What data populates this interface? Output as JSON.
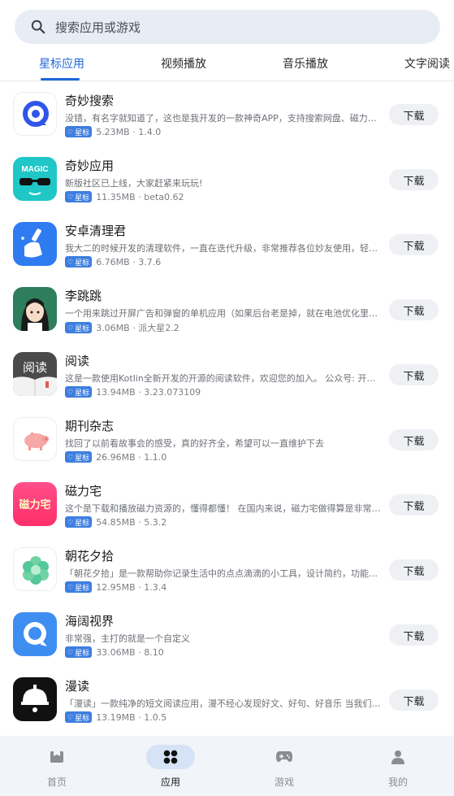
{
  "search": {
    "placeholder": "搜索应用或游戏",
    "icon": "search-icon"
  },
  "tabs": [
    {
      "label": "星标应用",
      "active": true
    },
    {
      "label": "视频播放",
      "active": false
    },
    {
      "label": "音乐播放",
      "active": false
    },
    {
      "label": "文字阅读",
      "active": false
    }
  ],
  "apps": [
    {
      "name": "奇妙搜索",
      "desc": "没错，有名字就知道了，这也是我开发的一款神奇APP，支持搜索网盘、磁力链接等",
      "badge": "星标",
      "meta": "5.23MB · 1.4.0",
      "button": "下载",
      "icon": "magic-search-icon"
    },
    {
      "name": "奇妙应用",
      "desc": "新版社区已上线，大家赶紧来玩玩!",
      "badge": "星标",
      "meta": "11.35MB · beta0.62",
      "button": "下载",
      "icon": "magic-app-icon",
      "icon_text": "MAGIC"
    },
    {
      "name": "安卓清理君",
      "desc": "我大二的时候开发的清理软件，一直在迭代升级，非常推荐各位妙友使用，轻量无广告",
      "badge": "星标",
      "meta": "6.76MB · 3.7.6",
      "button": "下载",
      "icon": "cleaner-icon"
    },
    {
      "name": "李跳跳",
      "desc": "一个用来跳过开屏广告和弹窗的单机应用（如果后台老是掉，就在电池优化里设置）",
      "badge": "星标",
      "meta": "3.06MB · 派大星2.2",
      "button": "下载",
      "icon": "li-tiaotiao-icon"
    },
    {
      "name": "阅读",
      "desc": "这是一款使用Kotlin全新开发的开源的阅读软件，欢迎您的加入。 公众号: 开源阅读",
      "badge": "星标",
      "meta": "13.94MB · 3.23.073109",
      "button": "下载",
      "icon": "legado-reader-icon",
      "icon_text": "阅读"
    },
    {
      "name": "期刊杂志",
      "desc": "找回了以前看故事会的感受，真的好齐全，希望可以一直维护下去",
      "badge": "星标",
      "meta": "26.96MB · 1.1.0",
      "button": "下载",
      "icon": "pig-magazine-icon"
    },
    {
      "name": "磁力宅",
      "desc": "这个是下载和播放磁力资源的，懂得都懂！ 在国内来说，磁力宅做得算是非常好了",
      "badge": "星标",
      "meta": "54.85MB · 5.3.2",
      "button": "下载",
      "icon": "magnet-house-icon",
      "icon_text": "磁力宅"
    },
    {
      "name": "朝花夕拾",
      "desc": "「朝花夕拾」是一款帮助你记录生活中的点点滴滴的小工具，设计简约，功能强大",
      "badge": "星标",
      "meta": "12.95MB · 1.3.4",
      "button": "下载",
      "icon": "flower-icon"
    },
    {
      "name": "海阔视界",
      "desc": "非常强，主打的就是一个自定义",
      "badge": "星标",
      "meta": "33.06MB · 8.10",
      "button": "下载",
      "icon": "haikuo-icon"
    },
    {
      "name": "漫读",
      "desc": "「漫读」一款纯净的短文阅读应用，漫不经心发现好文、好句、好音乐 当我们开始阅读",
      "badge": "星标",
      "meta": "13.19MB · 1.0.5",
      "button": "下载",
      "icon": "mandu-icon"
    }
  ],
  "bottom_nav": [
    {
      "label": "首页",
      "icon": "home-icon",
      "active": false
    },
    {
      "label": "应用",
      "icon": "apps-icon",
      "active": true
    },
    {
      "label": "游戏",
      "icon": "gamepad-icon",
      "active": false
    },
    {
      "label": "我的",
      "icon": "profile-icon",
      "active": false
    }
  ],
  "colors": {
    "accent": "#1e66d6",
    "badge": "#3d7ee0",
    "nav_active_bg": "#d6e2f5"
  }
}
